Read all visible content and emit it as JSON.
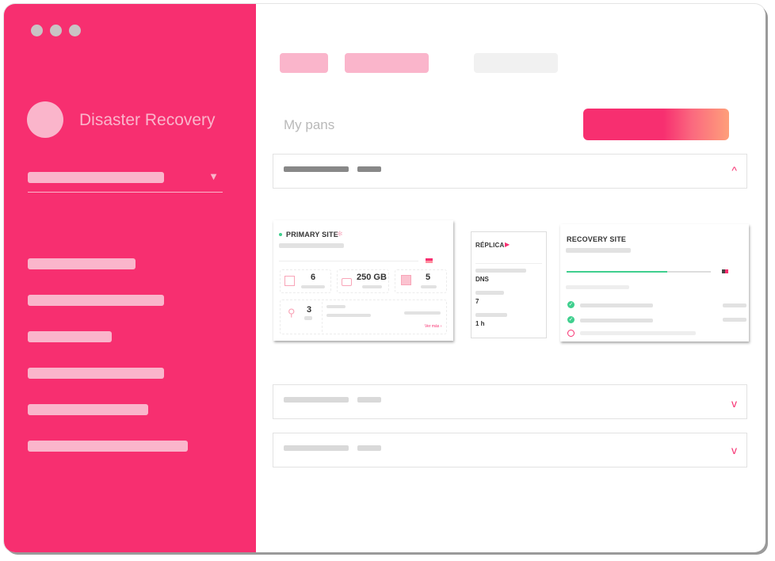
{
  "window": {
    "controls": [
      "close",
      "minimize",
      "maximize"
    ]
  },
  "sidebar": {
    "app_title": "Disaster Recovery",
    "avatar_icon": "user-avatar",
    "select_caret": "▼",
    "nav_item_count": 6
  },
  "main": {
    "page_heading": "My pans",
    "accordions": [
      {
        "chevron": "^",
        "expanded": true
      },
      {
        "chevron": "v",
        "expanded": false
      },
      {
        "chevron": "v",
        "expanded": false
      }
    ],
    "primary_site": {
      "title": "PRIMARY SITE",
      "status_color": "#3fcf8e",
      "stats": [
        {
          "icon": "server-icon",
          "value": "6"
        },
        {
          "icon": "disk-icon",
          "value": "250 GB"
        },
        {
          "icon": "network-icon",
          "value": "5"
        }
      ],
      "location": {
        "icon": "location-pin-icon",
        "value": "3"
      },
      "more_link": "Ver más ›"
    },
    "replica": {
      "title": "RÉPLICA",
      "play_icon": "▶",
      "items": [
        "DNS",
        "7",
        "1 h"
      ]
    },
    "recovery_site": {
      "title": "RECOVERY SITE",
      "progress": 0.7,
      "checks": [
        {
          "status": "done"
        },
        {
          "status": "done"
        },
        {
          "status": "pending"
        }
      ]
    }
  },
  "colors": {
    "brand": "#f72f70",
    "brand_light": "#fab5cb",
    "success": "#3fcf8e"
  }
}
